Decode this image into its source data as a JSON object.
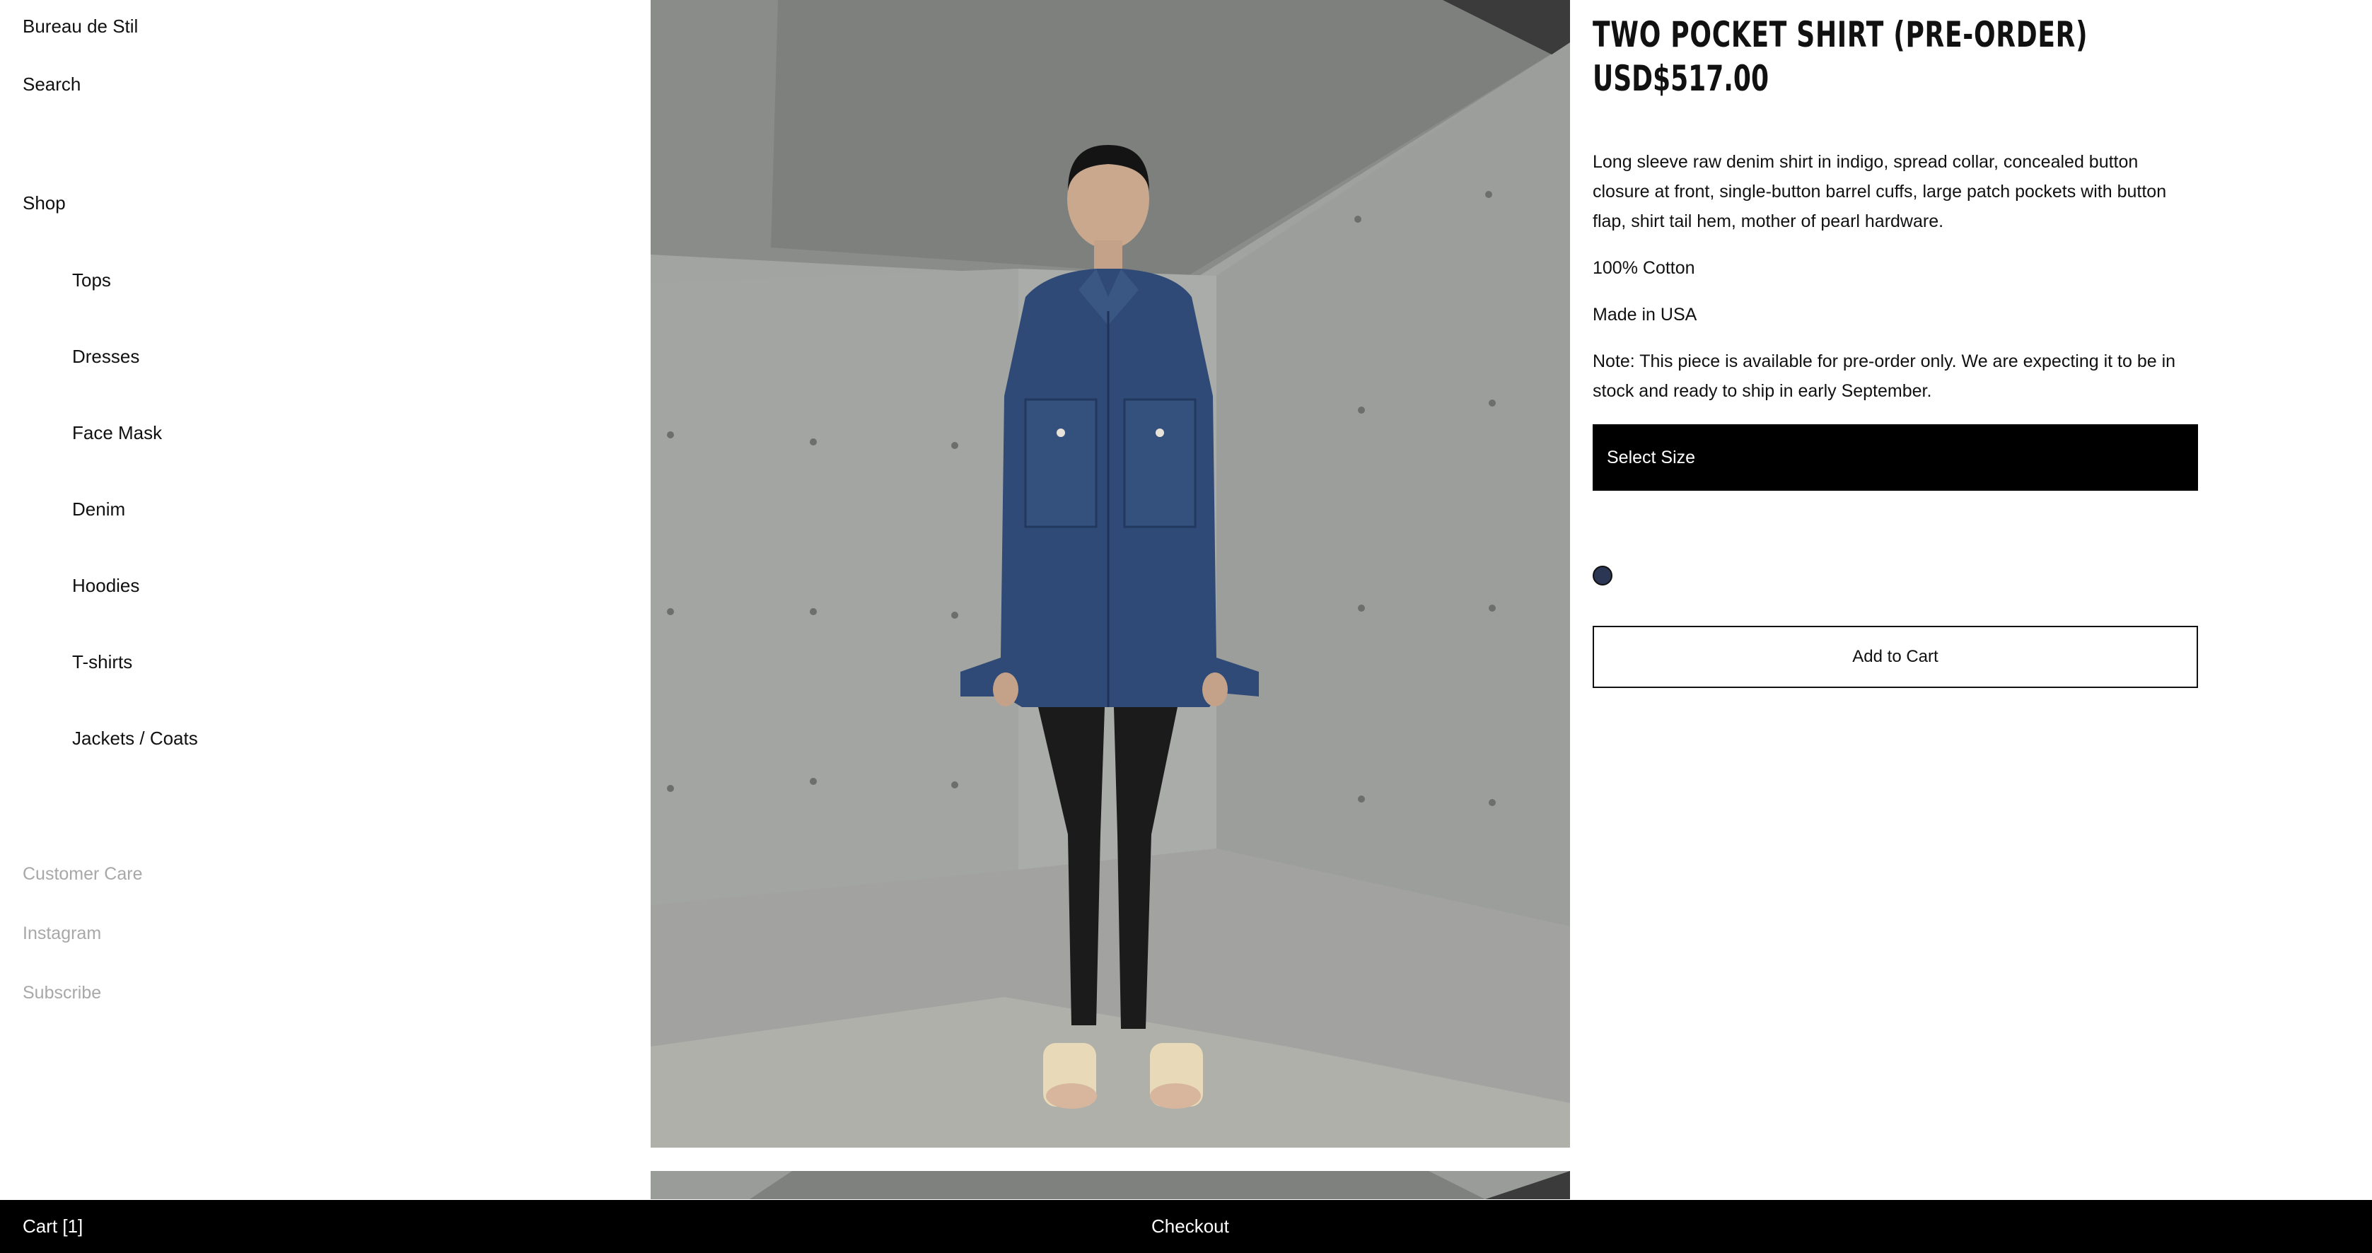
{
  "sidebar": {
    "brand": "Bureau de Stil",
    "search": "Search",
    "shop": "Shop",
    "categories": [
      "Tops",
      "Dresses",
      "Face Mask",
      "Denim",
      "Hoodies",
      "T-shirts",
      "Jackets / Coats"
    ],
    "footer_links": [
      "Customer Care",
      "Instagram",
      "Subscribe"
    ]
  },
  "product": {
    "title": "TWO POCKET SHIRT (PRE-ORDER)",
    "price": "USD$517.00",
    "description": [
      "Long sleeve raw denim shirt in indigo, spread collar, concealed button closure at front, single-button barrel cuffs, large patch pockets with button flap, shirt tail hem, mother of pearl hardware.",
      "100% Cotton",
      "Made in USA",
      "Note: This piece is available for pre-order only. We are expecting it to be in stock and ready to ship in early September."
    ],
    "size_select_label": "Select Size",
    "swatch_color": "#2a3654",
    "add_to_cart_label": "Add to Cart"
  },
  "bottom_bar": {
    "cart": "Cart [1]",
    "checkout": "Checkout"
  }
}
